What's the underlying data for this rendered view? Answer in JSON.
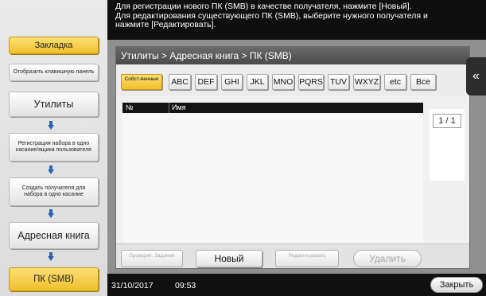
{
  "sidebar": {
    "bookmark": "Закладка",
    "show_keypad": "Отобразить клавишную панель",
    "utilities": "Утилиты",
    "onetouch_reg": "Регистрация набора в одно касание/ящика пользователя",
    "create_dest": "Создать получателя для набора в одно касание",
    "address_book": "Адресная книга",
    "pc_smb": "ПК (SMB)"
  },
  "message": {
    "line1": "Для регистрации нового ПК (SMB) в качестве получателя, нажмите [Новый].",
    "line2": "Для редактирования существующего ПК (SMB), выберите нужного получателя и",
    "line3": "нажмите [Редактировать]."
  },
  "breadcrumb": "Утилиты > Адресная книга > ПК (SMB)",
  "tabs": [
    "Собст-венные",
    "ABC",
    "DEF",
    "GHI",
    "JKL",
    "MNO",
    "PQRS",
    "TUV",
    "WXYZ",
    "etc",
    "Все"
  ],
  "list": {
    "col_no": "№",
    "col_name": "Имя"
  },
  "pager": {
    "text": "1 / 1"
  },
  "buttons": {
    "check_job": "Проверит. Задание",
    "new": "Новый",
    "edit": "Редакти-ровать",
    "delete": "Удалить"
  },
  "back_icon": "double-chevron-left-icon",
  "status": {
    "date": "31/10/2017",
    "time": "09:53",
    "close": "Закрыть"
  },
  "colors": {
    "accent_yellow": "#f0c02a",
    "arrow_blue": "#2d63b3",
    "bar_black": "#0f0f0f"
  }
}
